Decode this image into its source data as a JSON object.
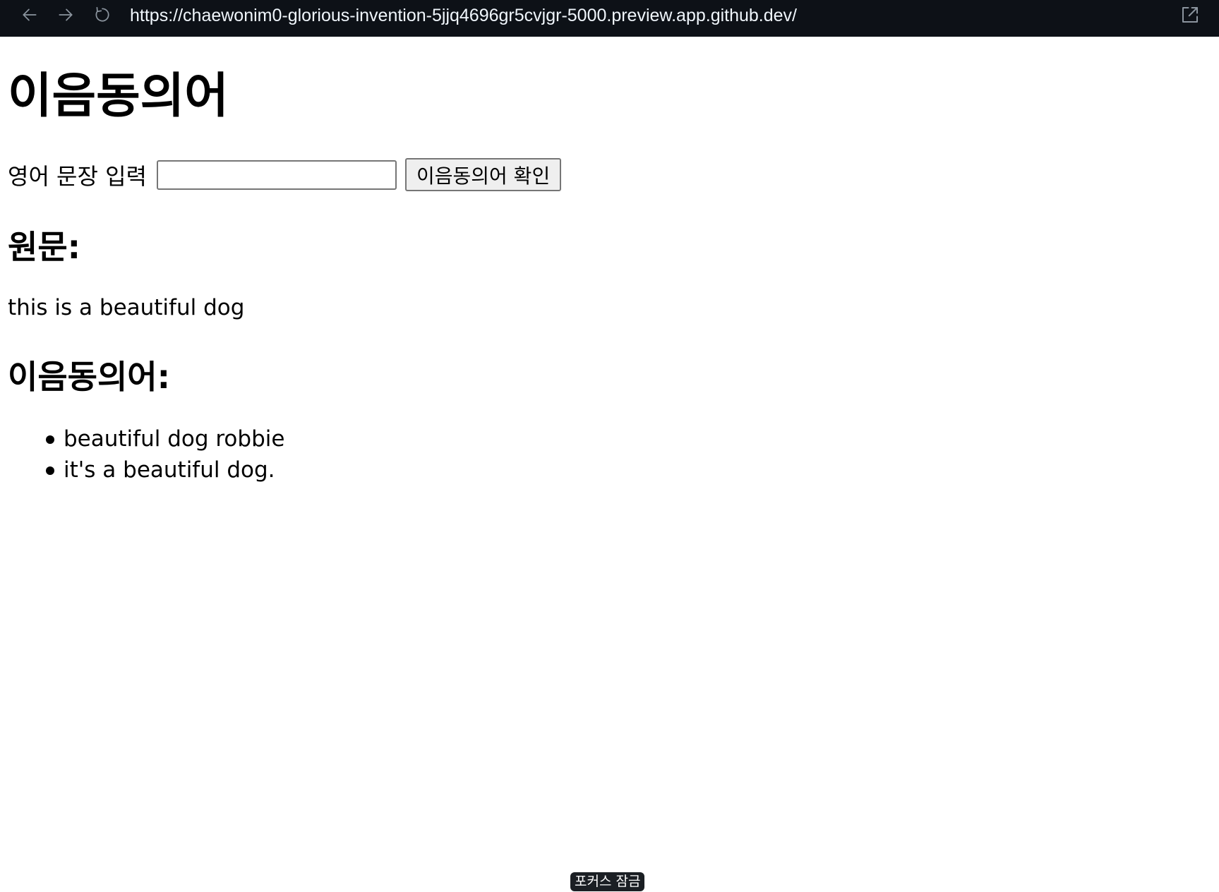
{
  "browser": {
    "url": "https://chaewonim0-glorious-invention-5jjq4696gr5cvjgr-5000.preview.app.github.dev/",
    "icons": {
      "back": "arrow-left-icon",
      "forward": "arrow-right-icon",
      "reload": "reload-icon",
      "external": "external-link-icon"
    }
  },
  "page": {
    "title": "이음동의어",
    "form": {
      "label": "영어 문장 입력",
      "input_value": "",
      "button_label": "이음동의어 확인"
    },
    "original_heading": "원문:",
    "original_text": "this is a beautiful dog",
    "synonyms_heading": "이음동의어:",
    "synonyms": [
      "beautiful dog robbie",
      "it's a beautiful dog."
    ]
  },
  "overlay": {
    "focus_lock_label": "포커스 잠금"
  },
  "colors": {
    "browser_bar": "#0d1117",
    "page_background": "#ffffff",
    "text": "#000000"
  }
}
